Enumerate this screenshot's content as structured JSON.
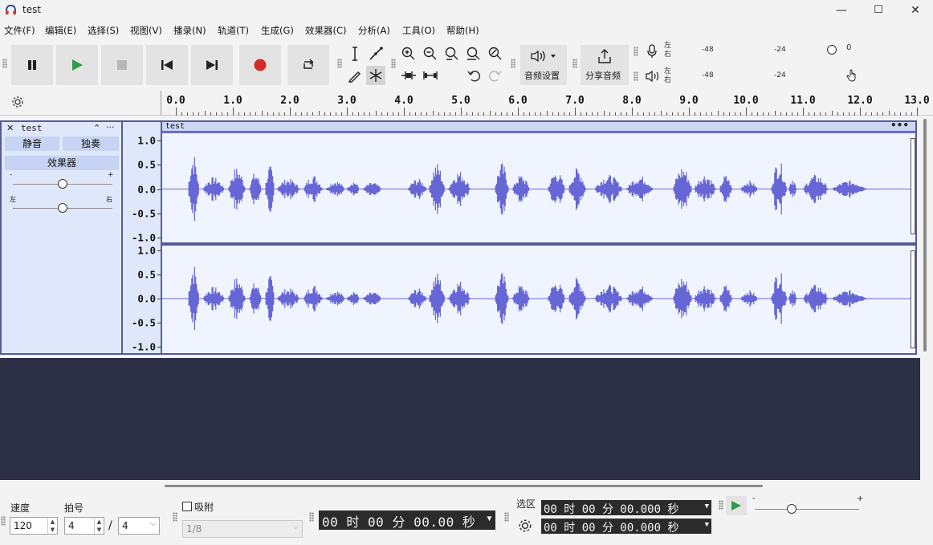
{
  "window": {
    "title": "test",
    "minimize": "—",
    "maximize": "☐",
    "close": "✕"
  },
  "menu": [
    "文件(F)",
    "编辑(E)",
    "选择(S)",
    "视图(V)",
    "播录(N)",
    "轨道(T)",
    "生成(G)",
    "效果器(C)",
    "分析(A)",
    "工具(O)",
    "帮助(H)"
  ],
  "toolbar": {
    "audio_settings_label": "音频设置",
    "share_audio_label": "分享音频"
  },
  "meters": {
    "record": {
      "lr": "左\n右",
      "ticks": [
        "-48",
        "-24",
        "0"
      ]
    },
    "play": {
      "lr": "左\n右",
      "ticks": [
        "-48",
        "-24"
      ]
    }
  },
  "ruler": {
    "ticks": [
      "0.0",
      "1.0",
      "2.0",
      "3.0",
      "4.0",
      "5.0",
      "6.0",
      "7.0",
      "8.0",
      "9.0",
      "10.0",
      "11.0",
      "12.0",
      "13.0"
    ]
  },
  "track": {
    "name": "test",
    "close_icon": "✕",
    "collapse_icon": "⌃",
    "menu_icon": "···",
    "mute_label": "静音",
    "solo_label": "独奏",
    "effects_label": "效果器",
    "gain_minus": "-",
    "gain_plus": "+",
    "pan_left": "左",
    "pan_right": "右",
    "gain_value": 0.5,
    "pan_value": 0.5
  },
  "clip": {
    "name": "test",
    "menu": "•••"
  },
  "vscale": {
    "labels": [
      "1.0",
      "0.5",
      "0.0",
      "-0.5",
      "-1.0"
    ]
  },
  "bottom": {
    "tempo_label": "速度",
    "tempo_value": "120",
    "beats_label": "拍号",
    "beats_num": "4",
    "beats_sep": "/",
    "beats_den": "4",
    "snap_label": "吸附",
    "snap_value": "1/8",
    "time_display": "00 时 00 分 00.00 秒",
    "selection_label": "选区",
    "sel_start": "00 时 00 分 00.000 秒",
    "sel_end": "00 时 00 分 00.000 秒",
    "play_speed_minus": "-",
    "play_speed_plus": "+",
    "play_speed_value": 0.35
  },
  "icons": [
    "headphones-icon",
    "pause-icon",
    "play-icon",
    "stop-icon",
    "skip-start-icon",
    "skip-end-icon",
    "record-icon",
    "loop-icon",
    "select-tool-icon",
    "envelope-tool-icon",
    "draw-tool-icon",
    "multi-tool-icon",
    "zoom-in-icon",
    "zoom-out-icon",
    "fit-selection-icon",
    "fit-project-icon",
    "zoom-toggle-icon",
    "trim-icon",
    "silence-icon",
    "undo-icon",
    "redo-icon",
    "speaker-icon",
    "share-icon",
    "microphone-icon",
    "gear-icon"
  ],
  "colors": {
    "waveform": "#6666d6",
    "clip_bg": "#f0f4ff",
    "track_border": "#555b9a",
    "empty_area": "#2c2f45",
    "record": "#d42a2a",
    "play": "#2f9a49"
  }
}
